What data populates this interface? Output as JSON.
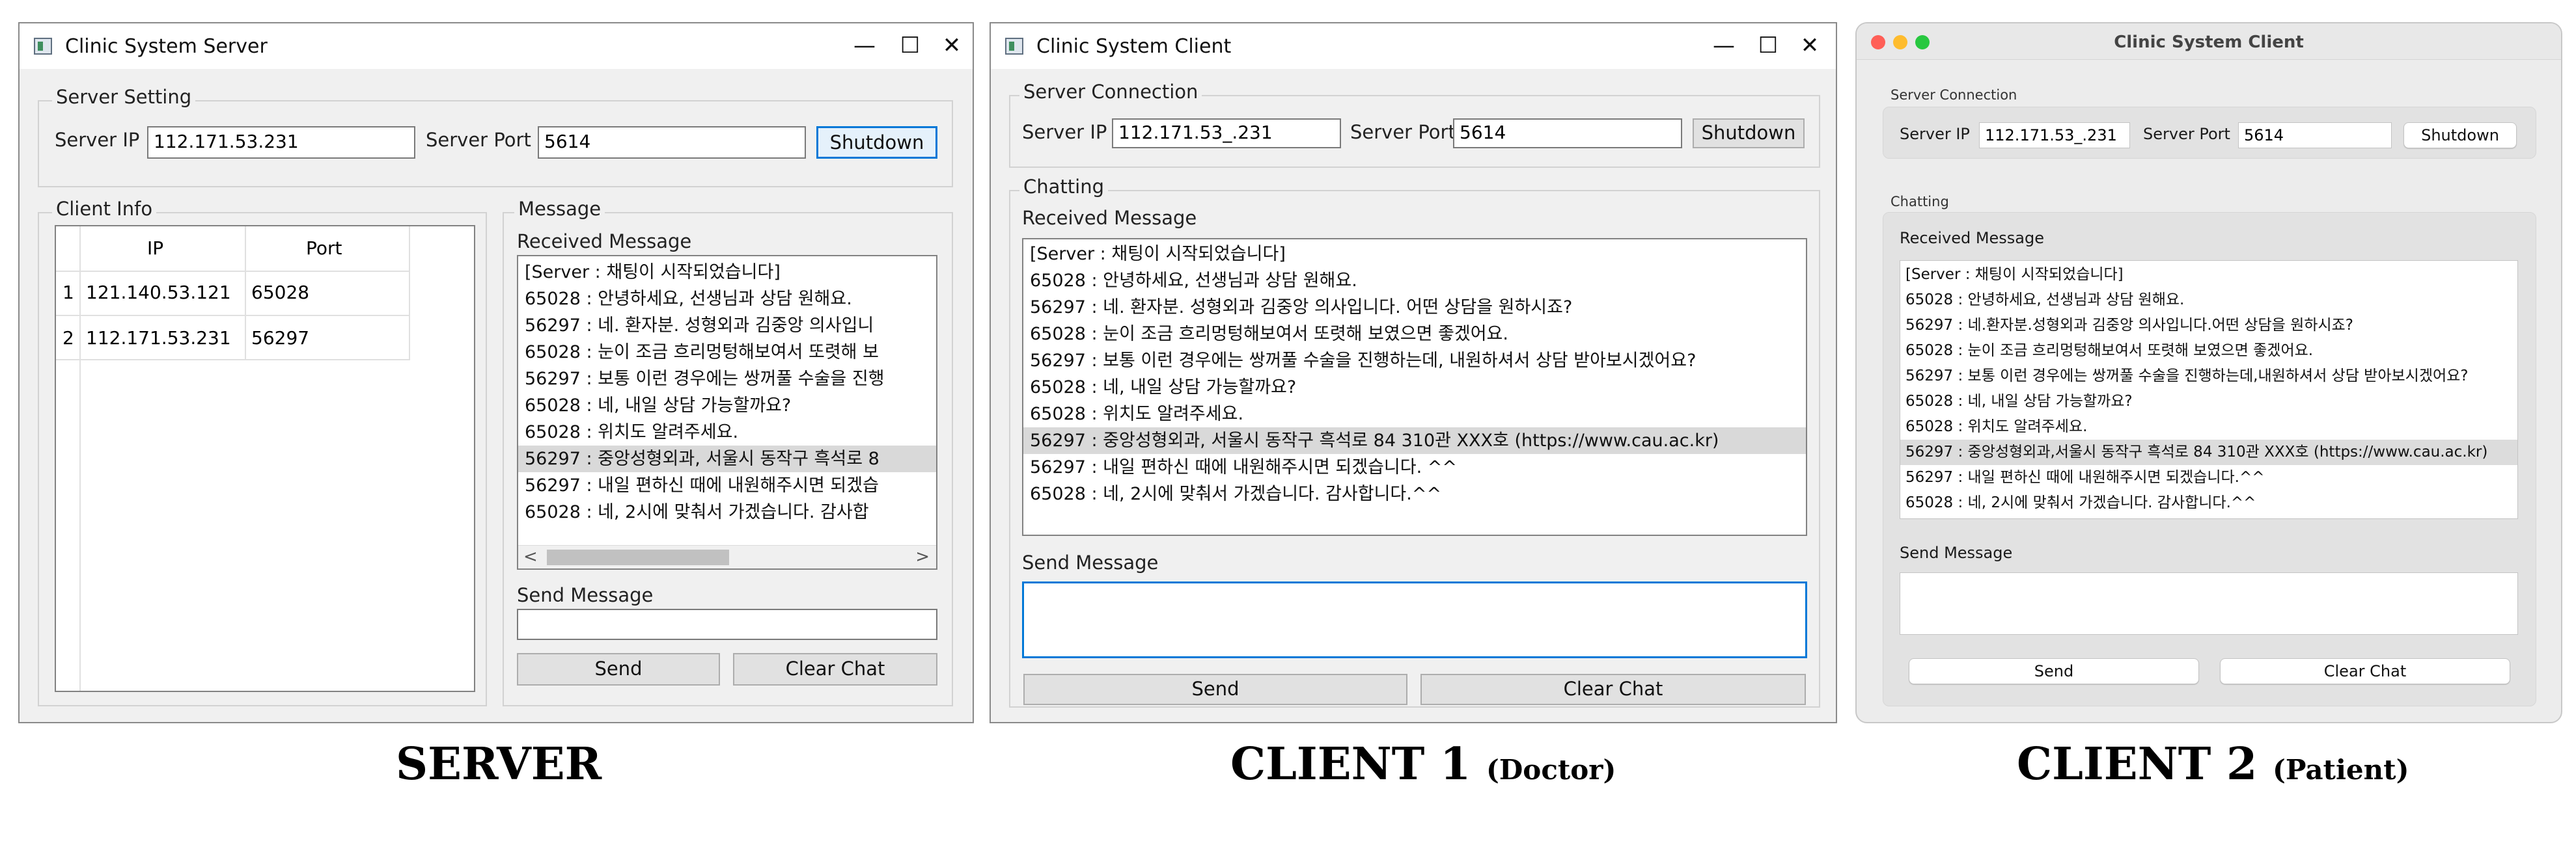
{
  "server": {
    "title": "Clinic System Server",
    "controls": {
      "minimize": "—",
      "maximize": "☐",
      "close": "✕"
    },
    "setting": {
      "group_label": "Server Setting",
      "ip_label": "Server IP",
      "ip_value": "112.171.53.231",
      "port_label": "Server Port",
      "port_value": "5614",
      "shutdown_label": "Shutdown"
    },
    "client_info": {
      "group_label": "Client Info",
      "columns": [
        "IP",
        "Port"
      ],
      "rows": [
        {
          "index": "1",
          "ip": "121.140.53.121",
          "port": "65028"
        },
        {
          "index": "2",
          "ip": "112.171.53.231",
          "port": "56297"
        }
      ]
    },
    "message": {
      "group_label": "Message",
      "received_label": "Received Message",
      "messages": [
        "[Server : 채팅이 시작되었습니다]",
        "65028 : 안녕하세요,  선생님과 상담 원해요.",
        "56297 : 네. 환자분. 성형외과 김중앙 의사입니",
        "65028 : 눈이 조금 흐리멍텅해보여서 또렷해 보",
        "56297 : 보통 이런 경우에는 쌍꺼풀 수술을 진행",
        "65028 : 네,  내일 상담 가능할까요?",
        "65028 : 위치도 알려주세요.",
        "56297 : 중앙성형외과, 서울시 동작구 흑석로 8",
        "56297 : 내일 편하신 때에 내원해주시면 되겠습",
        "65028 : 네,  2시에 맞춰서 가겠습니다.  감사합"
      ],
      "scroll_left": "<",
      "scroll_right": ">",
      "send_label": "Send Message",
      "send_value": "",
      "send_button": "Send",
      "clear_button": "Clear Chat"
    }
  },
  "client1": {
    "title": "Clinic System Client",
    "controls": {
      "minimize": "—",
      "maximize": "☐",
      "close": "✕"
    },
    "connection": {
      "group_label": "Server Connection",
      "ip_label": "Server IP",
      "ip_value": "112.171.53_.231",
      "port_label": "Server Port",
      "port_value": "5614",
      "shutdown_label": "Shutdown"
    },
    "chatting": {
      "group_label": "Chatting",
      "received_label": "Received Message",
      "messages": [
        "[Server : 채팅이 시작되었습니다]",
        "65028 : 안녕하세요,  선생님과 상담 원해요.",
        "56297 : 네. 환자분. 성형외과 김중앙 의사입니다. 어떤 상담을 원하시죠?",
        "65028 : 눈이 조금 흐리멍텅해보여서 또렷해 보였으면 좋겠어요.",
        "56297 : 보통 이런 경우에는 쌍꺼풀 수술을 진행하는데, 내원하셔서 상담 받아보시겠어요?",
        "65028 : 네,  내일 상담 가능할까요?",
        "65028 : 위치도 알려주세요.",
        "56297 : 중앙성형외과, 서울시 동작구 흑석로 84 310관 XXX호 (https://www.cau.ac.kr)",
        "56297 : 내일 편하신 때에 내원해주시면 되겠습니다. ^^",
        "65028 : 네,  2시에 맞춰서 가겠습니다.  감사합니다.^^"
      ],
      "send_label": "Send Message",
      "send_value": "",
      "send_button": "Send",
      "clear_button": "Clear Chat"
    }
  },
  "client2": {
    "title": "Clinic System Client",
    "connection": {
      "group_label": "Server Connection",
      "ip_label": "Server IP",
      "ip_value": "112.171.53_.231",
      "port_label": "Server Port",
      "port_value": "5614",
      "shutdown_label": "Shutdown"
    },
    "chatting": {
      "group_label": "Chatting",
      "received_label": "Received Message",
      "messages": [
        "[Server : 채팅이 시작되었습니다]",
        "65028 : 안녕하세요, 선생님과 상담 원해요.",
        "56297 : 네.환자분.성형외과 김중앙 의사입니다.어떤 상담을 원하시죠?",
        "65028 : 눈이 조금 흐리멍텅해보여서 또렷해 보였으면 좋겠어요.",
        "56297 : 보통 이런 경우에는 쌍꺼풀 수술을 진행하는데,내원하셔서 상담 받아보시겠어요?",
        "65028 : 네, 내일 상담 가능할까요?",
        "65028 : 위치도 알려주세요.",
        "56297 : 중앙성형외과,서울시 동작구 흑석로 84 310관 XXX호 (https://www.cau.ac.kr)",
        "56297 : 내일 편하신 때에 내원해주시면 되겠습니다.^^",
        "65028 : 네, 2시에 맞춰서 가겠습니다. 감사합니다.^^"
      ],
      "send_label": "Send Message",
      "send_value": "",
      "send_button": "Send",
      "clear_button": "Clear Chat"
    }
  },
  "captions": {
    "server": "SERVER",
    "client1_main": "CLIENT 1",
    "client1_sub": "(Doctor)",
    "client2_main": "CLIENT 2",
    "client2_sub": "(Patient)"
  },
  "colors": {
    "mac_close": "#ff5f57",
    "mac_minimize": "#febc2e",
    "mac_zoom": "#28c840",
    "focus_accent": "#0078d7"
  }
}
